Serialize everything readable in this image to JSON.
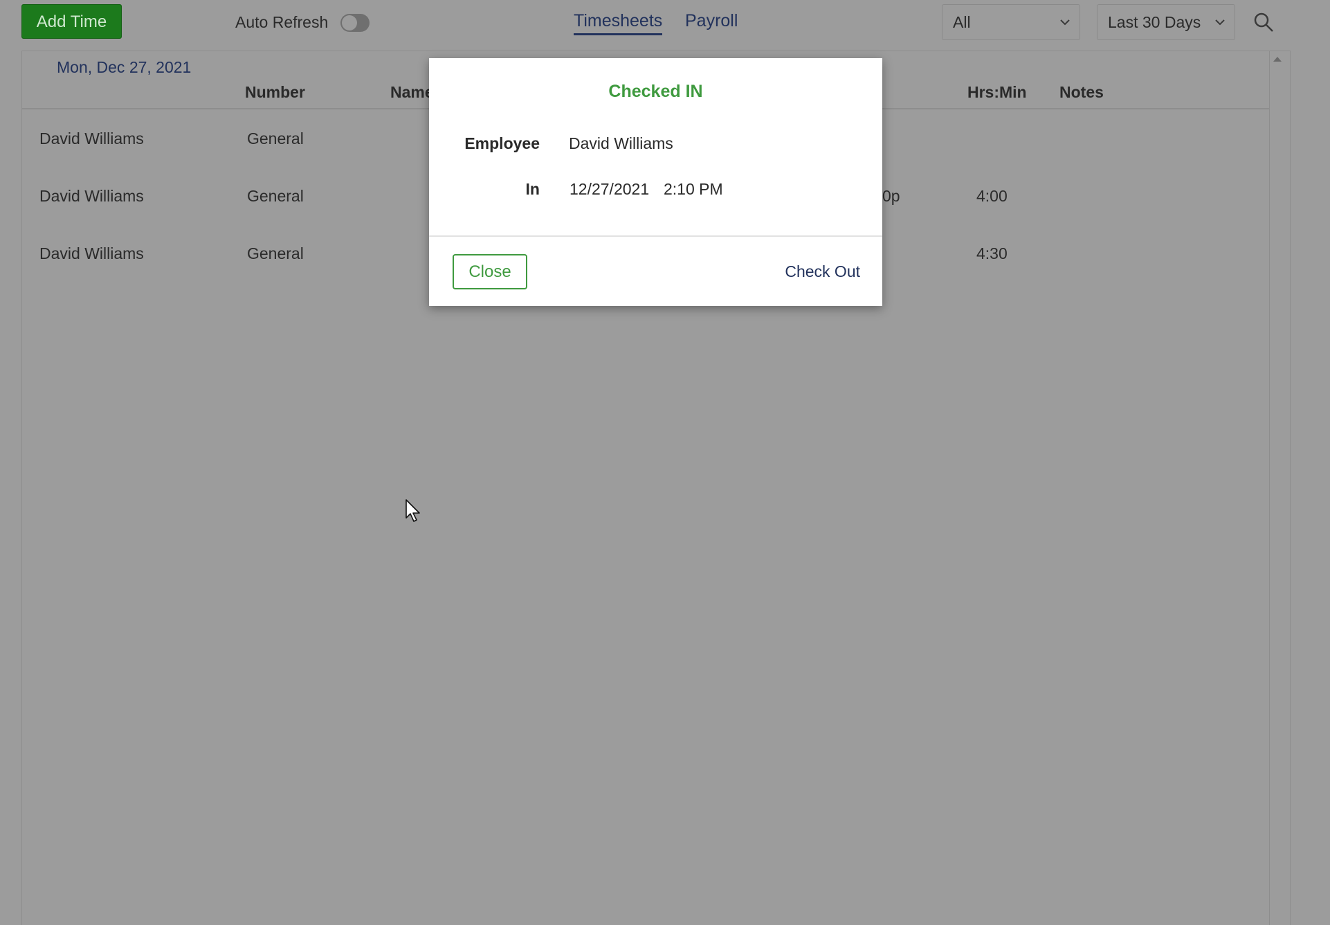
{
  "toolbar": {
    "add_time_label": "Add Time",
    "auto_refresh_label": "Auto Refresh",
    "auto_refresh_on": false,
    "tabs": [
      {
        "label": "Timesheets",
        "active": true
      },
      {
        "label": "Payroll",
        "active": false
      }
    ],
    "filter_select": {
      "value": "All"
    },
    "range_select": {
      "value": "Last 30 Days"
    },
    "search_icon": "search-icon"
  },
  "table": {
    "date_label": "Mon, Dec 27, 2021",
    "headers": {
      "number": "Number",
      "name": "Name",
      "hrs_min": "Hrs:Min",
      "notes": "Notes"
    },
    "rows": [
      {
        "employee": "David Williams",
        "number": "General",
        "time_fragment": "",
        "hrs_min": ""
      },
      {
        "employee": "David Williams",
        "number": "General",
        "time_fragment": "0p",
        "hrs_min": "4:00"
      },
      {
        "employee": "David Williams",
        "number": "General",
        "time_fragment": "",
        "hrs_min": "4:30"
      }
    ]
  },
  "modal": {
    "title": "Checked IN",
    "employee_label": "Employee",
    "employee_value": "David Williams",
    "in_label": "In",
    "in_date": "12/27/2021",
    "in_time": "2:10 PM",
    "close_label": "Close",
    "checkout_label": "Check Out"
  },
  "colors": {
    "accent_green": "#3f9a3f",
    "button_green": "#1c7a1c",
    "link_navy": "#22325c",
    "overlay_gray": "#9c9c9c"
  }
}
